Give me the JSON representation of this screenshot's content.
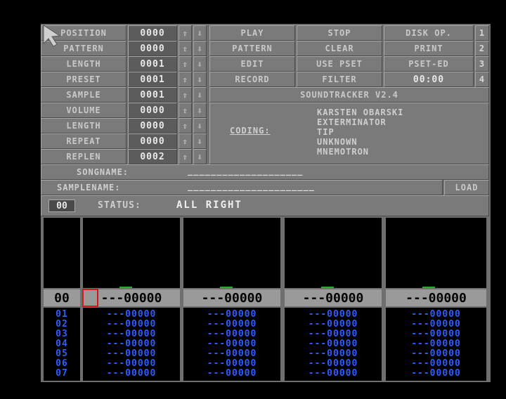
{
  "left_labels": [
    "POSITION",
    "PATTERN",
    "LENGTH",
    "PRESET"
  ],
  "left_values": [
    "0000",
    "0000",
    "0001",
    "0001"
  ],
  "sample_labels": [
    "SAMPLE",
    "VOLUME",
    "LENGTH",
    "REPEAT",
    "REPLEN"
  ],
  "sample_values": [
    "0001",
    "0000",
    "0000",
    "0000",
    "0002"
  ],
  "arrows": {
    "up": "⇧",
    "down": "⇩"
  },
  "menu": [
    [
      "PLAY",
      "STOP",
      "DISK OP.",
      "1"
    ],
    [
      "PATTERN",
      "CLEAR",
      "PRINT",
      "2"
    ],
    [
      "EDIT",
      "USE PSET",
      "PSET-ED",
      "3"
    ],
    [
      "RECORD",
      "FILTER",
      "00:00",
      "4"
    ]
  ],
  "title": "SOUNDTRACKER V2.4",
  "coding_label": "CODING:",
  "credits": [
    "KARSTEN OBARSKI",
    "EXTERMINATOR",
    "TIP",
    "UNKNOWN",
    "MNEMOTRON"
  ],
  "songname_label": "SONGNAME:",
  "songname_value": "____________________",
  "samplename_label": "SAMPLENAME:",
  "samplename_value": "______________________",
  "load_label": "LOAD",
  "status_num": "00",
  "status_label": "STATUS:",
  "status_value": "ALL RIGHT",
  "pattern_row": "00",
  "channel_headers": [
    "---00000",
    "---00000",
    "---00000",
    "---00000"
  ],
  "row_numbers": [
    "01",
    "02",
    "03",
    "04",
    "05",
    "06",
    "07"
  ],
  "track_rows": [
    "---00000",
    "---00000",
    "---00000",
    "---00000",
    "---00000",
    "---00000",
    "---00000"
  ],
  "colors": {
    "accent_green": "#2fa82f",
    "track_blue": "#2f5cff",
    "cursor_red": "#d01818"
  }
}
